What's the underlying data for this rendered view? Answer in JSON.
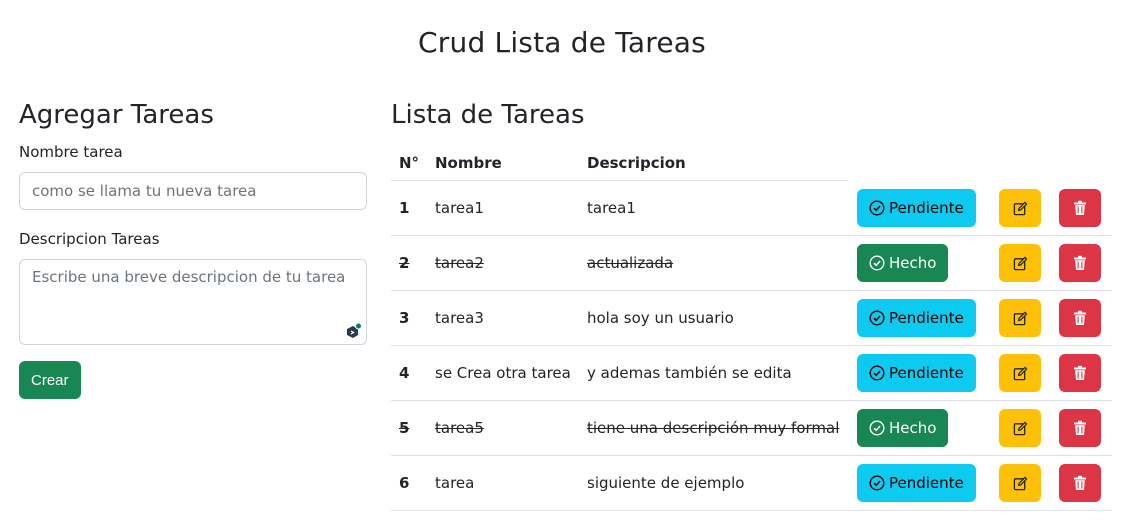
{
  "page": {
    "title": "Crud Lista de Tareas"
  },
  "form": {
    "heading": "Agregar Tareas",
    "name_label": "Nombre tarea",
    "name_placeholder": "como se llama tu nueva tarea",
    "desc_label": "Descripcion Tareas",
    "desc_placeholder": "Escribe una breve descripcion de tu tarea",
    "create_label": "Crear"
  },
  "list": {
    "heading": "Lista de Tareas",
    "columns": [
      "N°",
      "Nombre",
      "Descripcion"
    ],
    "rows": [
      {
        "num": "1",
        "name": "tarea1",
        "desc": "tarea1",
        "status": "Pendiente",
        "done": false
      },
      {
        "num": "2",
        "name": "tarea2",
        "desc": "actualizada",
        "status": "Hecho",
        "done": true
      },
      {
        "num": "3",
        "name": "tarea3",
        "desc": "hola soy un usuario",
        "status": "Pendiente",
        "done": false
      },
      {
        "num": "4",
        "name": "se Crea otra tarea",
        "desc": "y ademas también se edita",
        "status": "Pendiente",
        "done": false
      },
      {
        "num": "5",
        "name": "tarea5",
        "desc": "tiene una descripción muy formal",
        "status": "Hecho",
        "done": true
      },
      {
        "num": "6",
        "name": "tarea",
        "desc": "siguiente de ejemplo",
        "status": "Pendiente",
        "done": false
      }
    ]
  },
  "icons": {
    "status": "check-circle-icon",
    "edit": "pencil-square-icon",
    "delete": "trash-icon",
    "grammar": "extension-badge-icon"
  },
  "colors": {
    "pending": "#0dcaf0",
    "done": "#198754",
    "edit": "#ffc107",
    "delete": "#dc3545",
    "create": "#198754"
  }
}
